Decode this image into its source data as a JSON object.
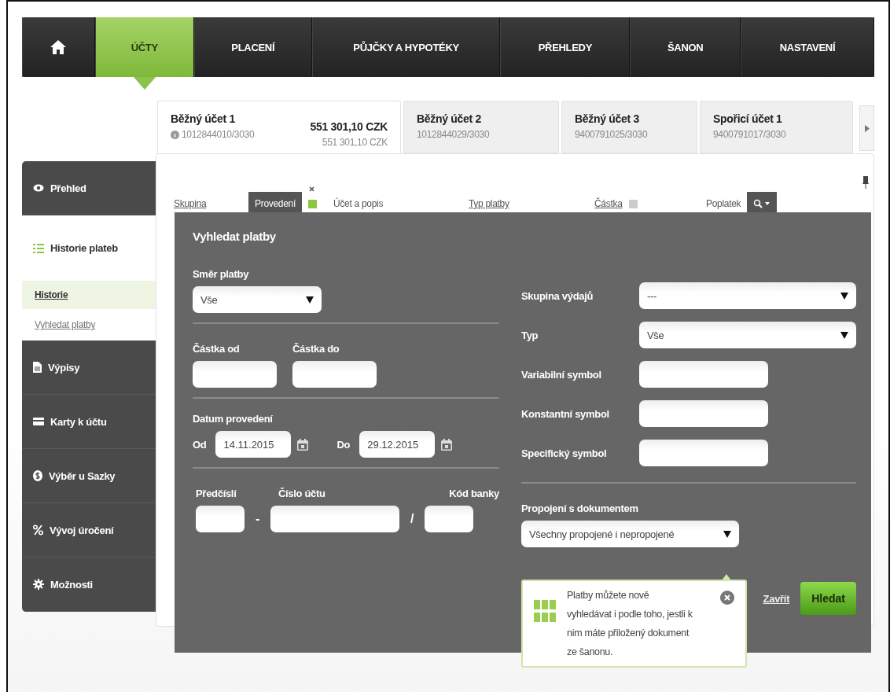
{
  "nav": {
    "items": [
      {
        "kind": "home",
        "selected": false
      },
      {
        "kind": "text",
        "label": "ÚČTY",
        "selected": true
      },
      {
        "kind": "text",
        "label": "PLACENÍ",
        "selected": false
      },
      {
        "kind": "text",
        "label": "PŮJČKY A HYPOTÉKY",
        "selected": false
      },
      {
        "kind": "text",
        "label": "PŘEHLEDY",
        "selected": false
      },
      {
        "kind": "text",
        "label": "ŠANON",
        "selected": false
      },
      {
        "kind": "text",
        "label": "NASTAVENÍ",
        "selected": false
      }
    ]
  },
  "account_tabs": [
    {
      "name": "Běžný účet 1",
      "number": "1012844010/3030",
      "balance": "551 301,10 CZK",
      "available": "551 301,10 CZK",
      "info": true,
      "selected": true
    },
    {
      "name": "Běžný účet 2",
      "number": "1012844029/3030",
      "info": false,
      "selected": false
    },
    {
      "name": "Běžný účet 3",
      "number": "9400791025/3030",
      "info": false,
      "selected": false
    },
    {
      "name": "Spořicí účet 1",
      "number": "9400791017/3030",
      "info": false,
      "selected": false
    }
  ],
  "sidebar": {
    "items": [
      {
        "label": "Přehled",
        "selected": false
      },
      {
        "label": "Historie plateb",
        "selected": true,
        "children": [
          {
            "label": "Historie",
            "selected": true
          },
          {
            "label": "Vyhledat platby",
            "selected": false
          }
        ]
      },
      {
        "label": "Výpisy",
        "selected": false
      },
      {
        "label": "Karty k účtu",
        "selected": false
      },
      {
        "label": "Výběr u Sazky",
        "selected": false
      },
      {
        "label": "Vývoj úročení",
        "selected": false
      },
      {
        "label": "Možnosti",
        "selected": false
      }
    ]
  },
  "table": {
    "columns": [
      {
        "label": "Skupina",
        "sortable": true,
        "selected": false,
        "sort_button": false
      },
      {
        "label": "Provedení",
        "sortable": false,
        "selected": true,
        "sort_button": true
      },
      {
        "label": "Účet a popis",
        "sortable": false,
        "selected": false,
        "sort_button": false
      },
      {
        "label": "Typ platby",
        "sortable": true,
        "selected": false,
        "sort_button": false
      },
      {
        "label": "Částka",
        "sortable": true,
        "selected": false,
        "sort_button": true
      },
      {
        "label": "Poplatek",
        "sortable": false,
        "selected": false,
        "sort_button": false
      }
    ]
  },
  "search_dialog": {
    "title": "Vyhledat platby",
    "direction": {
      "label": "Směr platby",
      "value": "Vše"
    },
    "amount": {
      "from_label": "Částka od",
      "to_label": "Částka do"
    },
    "date": {
      "label": "Datum provedení",
      "from_label": "Od",
      "from_value": "14.11.2015",
      "to_label": "Do",
      "to_value": "29.12.2015"
    },
    "account": {
      "prefix_label": "Předčíslí",
      "number_label": "Číslo účtu",
      "bank_label": "Kód banky",
      "dash": "-",
      "slash": "/"
    },
    "expense_group": {
      "label": "Skupina výdajů",
      "value": "---"
    },
    "type": {
      "label": "Typ",
      "value": "Vše"
    },
    "symbols": [
      {
        "label": "Variabilní symbol"
      },
      {
        "label": "Konstantní symbol"
      },
      {
        "label": "Specifický symbol"
      }
    ],
    "document_link": {
      "label": "Propojení s dokumentem",
      "value": "Všechny propojené i nepropojené"
    },
    "tooltip": {
      "text": "Platby můžete nově vyhledávat i podle toho, jestli k nim máte přiložený dokument ze šanonu."
    },
    "close_link": "Zavřít",
    "search_button": "Hledat"
  }
}
